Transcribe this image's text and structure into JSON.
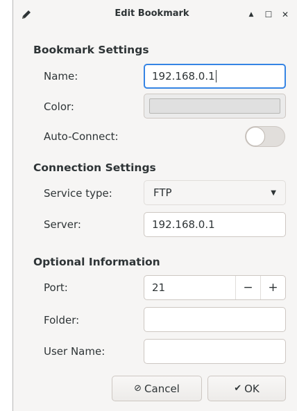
{
  "window": {
    "title": "Edit Bookmark",
    "controls": {
      "minimize": "▲",
      "maximize": "☐",
      "close": "✕"
    }
  },
  "bookmark_settings": {
    "heading": "Bookmark Settings",
    "name_label": "Name:",
    "name_value": "192.168.0.1",
    "color_label": "Color:",
    "auto_connect_label": "Auto-Connect:",
    "auto_connect_on": false
  },
  "connection_settings": {
    "heading": "Connection Settings",
    "service_type_label": "Service type:",
    "service_type_value": "FTP",
    "server_label": "Server:",
    "server_value": "192.168.0.1"
  },
  "optional_information": {
    "heading": "Optional Information",
    "port_label": "Port:",
    "port_value": "21",
    "minus": "−",
    "plus": "+",
    "folder_label": "Folder:",
    "folder_value": "",
    "username_label": "User Name:",
    "username_value": ""
  },
  "buttons": {
    "cancel_icon": "⊘",
    "cancel_label": "Cancel",
    "ok_icon": "✔",
    "ok_label": "OK"
  },
  "colors": {
    "focus_accent": "#3584e4",
    "window_bg": "#f6f5f4"
  },
  "icons": {
    "title": "pencil-icon",
    "combo": "chevron-down-icon"
  }
}
